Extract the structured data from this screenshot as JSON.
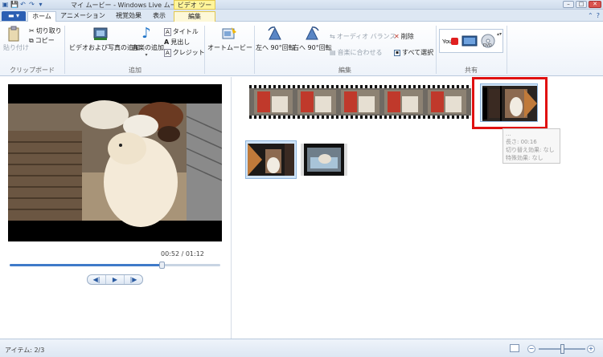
{
  "window": {
    "title": "マイ ムービー - Windows Live ムービー ...",
    "context_tab_title": "ビデオ ツール",
    "minimize": "–",
    "maximize": "□",
    "close": "✕"
  },
  "quick_access": {
    "save_icon": "save-icon",
    "undo_icon": "undo-icon",
    "redo_icon": "redo-icon"
  },
  "tabs": [
    {
      "label": "ホーム",
      "active": true
    },
    {
      "label": "アニメーション"
    },
    {
      "label": "視覚効果"
    },
    {
      "label": "表示"
    },
    {
      "label": "編集",
      "context": true
    }
  ],
  "ribbon": {
    "clipboard": {
      "label": "クリップボード",
      "paste": "貼り付け",
      "cut": "切り取り",
      "copy": "コピー"
    },
    "add": {
      "label": "追加",
      "add_videos_photos": "ビデオおよび写真の追加",
      "add_music": "音楽の追加",
      "title": "タイトル",
      "caption": "見出し",
      "credits": "クレジット"
    },
    "automovie": "オートムービー",
    "editing": {
      "label": "編集",
      "rotate_left": "左へ 90°回転",
      "rotate_right": "右へ 90°回転",
      "audio_balance": "オーディオ バランス",
      "fit_to_music": "音楽に合わせる",
      "remove": "削除",
      "select_all": "すべて選択"
    },
    "share": {
      "label": "共有"
    }
  },
  "preview": {
    "time": "00:52 / 01:12",
    "progress": 0.72
  },
  "tooltip": {
    "lines": [
      "...",
      "長さ: 00:16",
      "切り替え効果: なし",
      "特殊効果: なし"
    ]
  },
  "status": {
    "items": "アイテム: 2/3",
    "zoom_level": 0.5
  }
}
